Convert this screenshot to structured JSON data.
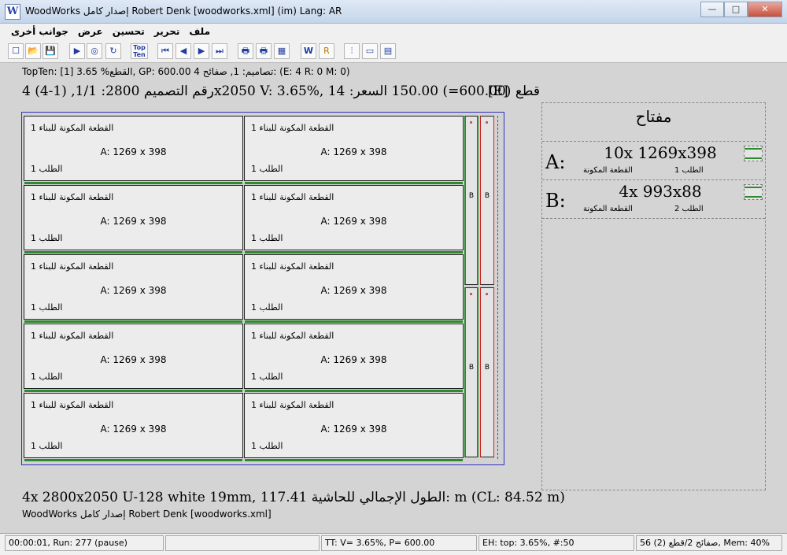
{
  "window": {
    "icon": "W",
    "title": "WoodWorks إصدار كامل Robert Denk [woodworks.xml] (im) Lang: AR",
    "minimize": "—",
    "maximize": "□",
    "close": "✕"
  },
  "menu": [
    "ملف",
    "تحرير",
    "تحسين",
    "عرض",
    "جوانب أخرى"
  ],
  "toolbar": {
    "new": "☐",
    "open": "📂",
    "save": "💾",
    "run": "▶",
    "stop": "◎",
    "refresh": "↻",
    "topten": "Top Ten",
    "first": "⏮",
    "prev": "◀",
    "next": "▶",
    "last": "⏭",
    "print": "🖶",
    "print2": "🖶",
    "grid": "▦",
    "ww": "W",
    "key": "R",
    "sliders": "⫶",
    "view1": "▭",
    "view2": "▤"
  },
  "info": {
    "line1": "TopTen: [1] 3.65 %القطع, GP: 600.00 4 تصاميم: 1, صفائح: (E: 4 R: 0 M: 0)",
    "line2": "4 (4-1) ,1/1 :رقم التصميم 2800x2050 V:  3.65%, 14 :قطع (600.00=) 150.00 السعر",
    "tag": "[E]"
  },
  "board": {
    "part_top_label": "القطعة المكونة للبناء 1",
    "part_mid_label": "A: 1269 x 398",
    "part_bot_label": "الطلب 1",
    "strip_label": "B"
  },
  "legend": {
    "title": "مفتاح",
    "rows": [
      {
        "letter": "A:",
        "dims": "10x 1269x398",
        "part": "القطعة المكونة",
        "order": "الطلب 1"
      },
      {
        "letter": "B:",
        "dims": "4x 993x88",
        "part": "القطعة المكونة",
        "order": "الطلب 2"
      }
    ]
  },
  "summary": "4x 2800x2050 U-128 white 19mm, 117.41 الطول الإجمالي للحاشية: m (CL: 84.52 m)",
  "version": "WoodWorks إصدار كامل Robert Denk [woodworks.xml]",
  "status": {
    "time": "00:00:01, Run: 277 (pause)",
    "empty": "",
    "tt": "TT: V= 3.65%, P= 600.00",
    "eh": "EH: top: 3.65%,  #:50",
    "sheets": "56 (2) صفائح 2/قطع, Mem: 40%"
  },
  "colors": {
    "accent_green": "#2e8a2e",
    "accent_red": "#d02020",
    "board_border": "#3030c0"
  }
}
